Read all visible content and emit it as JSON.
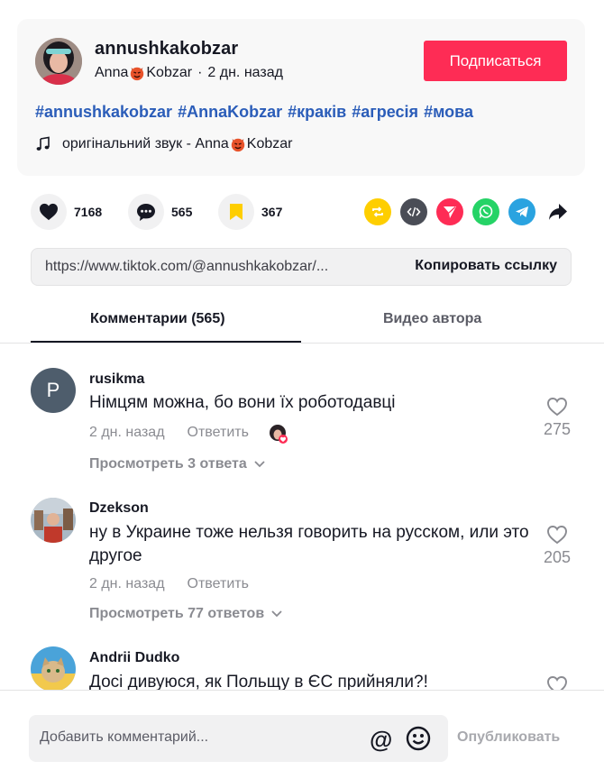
{
  "post": {
    "username": "annushkakobzar",
    "display_name_part1": "Anna",
    "display_name_part2": "Kobzar",
    "time_sep": "·",
    "time": "2 дн. назад",
    "follow_label": "Подписаться",
    "hashtags": [
      "#annushkakobzar",
      "#AnnaKobzar",
      "#краків",
      "#агресія",
      "#мова"
    ],
    "sound_prefix": "оригінальний звук - Anna",
    "sound_suffix": "Kobzar"
  },
  "actions": {
    "likes": "7168",
    "comments": "565",
    "saves": "367"
  },
  "share_icons": [
    "repost-icon",
    "embed-icon",
    "send-icon",
    "whatsapp-icon",
    "telegram-icon",
    "share-arrow-icon"
  ],
  "link": {
    "url": "https://www.tiktok.com/@annushkakobzar/...",
    "copy_label": "Копировать ссылку"
  },
  "tabs": {
    "comments_label": "Комментарии (565)",
    "videos_label": "Видео автора"
  },
  "comments": [
    {
      "avatar_letter": "P",
      "user": "rusikma",
      "text": "Німцям можна, бо вони їх роботодавці",
      "time": "2 дн. назад",
      "reply_label": "Ответить",
      "likes": "275",
      "view_replies": "Просмотреть 3 ответа"
    },
    {
      "user": "Dzekson",
      "text": "ну в Украине тоже нельзя говорить на русском, или это другое",
      "time": "2 дн. назад",
      "reply_label": "Ответить",
      "likes": "205",
      "view_replies": "Просмотреть 77 ответов"
    },
    {
      "user": "Andrii Dudko",
      "text": "Досі дивуюся, як Польщу в ЄС прийняли?!"
    }
  ],
  "footer": {
    "placeholder": "Добавить комментарий...",
    "at_symbol": "@",
    "publish_label": "Опубликовать"
  },
  "colors": {
    "accent": "#fe2c55",
    "hashtag": "#2b5db9",
    "muted": "#8a8b91"
  }
}
